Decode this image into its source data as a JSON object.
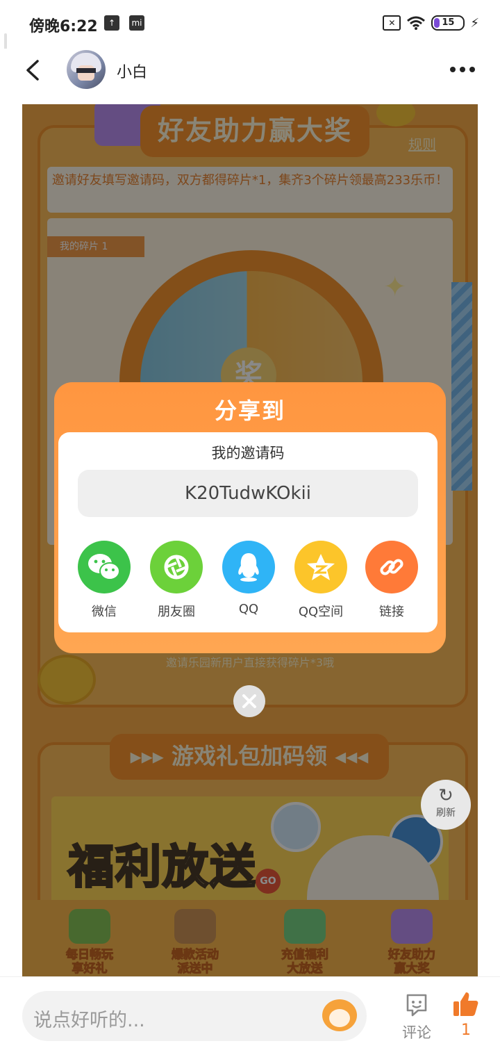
{
  "status_bar": {
    "time": "傍晚6:22",
    "battery_level": "15"
  },
  "header": {
    "username": "小白"
  },
  "activity": {
    "title": "好友助力赢大奖",
    "rules_link": "规则",
    "description": "邀请好友填写邀请码，双方都得碎片*1，集齐3个碎片领最高233乐币！",
    "my_shards_tag": "我的碎片 1",
    "prize_char": "奖",
    "bottom_note": "邀请乐园新用户直接获得碎片*3哦",
    "section2_title": "▸▸▸ 游戏礼包加码领 ◂◂◂",
    "banner_text": "福利放送",
    "banner_go": "GO",
    "tabs": [
      {
        "line1": "每日畅玩",
        "line2": "享好礼"
      },
      {
        "line1": "爆款活动",
        "line2": "派送中"
      },
      {
        "line1": "充值福利",
        "line2": "大放送"
      },
      {
        "line1": "好友助力",
        "line2": "赢大奖"
      }
    ],
    "refresh_label": "刷新"
  },
  "share_modal": {
    "title": "分享到",
    "code_label": "我的邀请码",
    "invite_code": "K20TudwKOkii",
    "options": [
      {
        "label": "微信",
        "color": "#3cc34a",
        "icon": "wechat-icon"
      },
      {
        "label": "朋友圈",
        "color": "#6cd13a",
        "icon": "moments-icon"
      },
      {
        "label": "QQ",
        "color": "#2fb4f6",
        "icon": "qq-icon"
      },
      {
        "label": "QQ空间",
        "color": "#fcc52a",
        "icon": "qzone-icon"
      },
      {
        "label": "链接",
        "color": "#ff7a38",
        "icon": "link-icon"
      }
    ]
  },
  "bottom_bar": {
    "comment_placeholder": "说点好听的...",
    "comment_label": "评论",
    "like_count": "1",
    "accent_color": "#f07a2a"
  }
}
